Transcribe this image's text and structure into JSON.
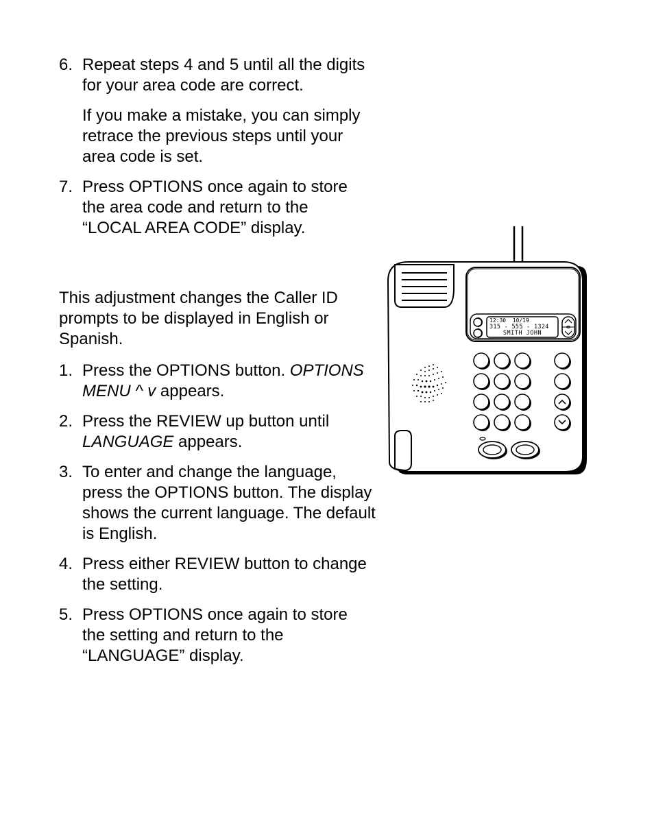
{
  "cont_list": {
    "items": [
      {
        "num": "6.",
        "paras": [
          "Repeat steps 4 and 5 until all the digits for your area code are correct.",
          "If you make a mistake, you can simply retrace the previous steps until your area code is set."
        ]
      },
      {
        "num": "7.",
        "paras": [
          "Press OPTIONS once again to store the area code and return to the “LOCAL AREA CODE” display."
        ]
      }
    ]
  },
  "intro": "This adjustment changes the Caller ID prompts to be displayed in English or Spanish.",
  "lang_list": {
    "items": [
      {
        "num": "1.",
        "pre": "Press the OPTIONS button. ",
        "em": "OPTIONS MENU ^ v",
        "post": " appears."
      },
      {
        "num": "2.",
        "pre": "Press the REVIEW up button until ",
        "em": "LANGUAGE",
        "post": " appears."
      },
      {
        "num": "3.",
        "pre": "To enter and change the language, press the OPTIONS button. The display shows the current language. The default is English.",
        "em": "",
        "post": ""
      },
      {
        "num": "4.",
        "pre": "Press either REVIEW button to change the setting.",
        "em": "",
        "post": ""
      },
      {
        "num": "5.",
        "pre": "Press OPTIONS once again to store the setting and return to the “LANGUAGE” display.",
        "em": "",
        "post": ""
      }
    ]
  },
  "lcd": {
    "line1": "12:30  10/19",
    "line2": "315 - 555 - 1324",
    "line3": "SMITH JOHN"
  }
}
